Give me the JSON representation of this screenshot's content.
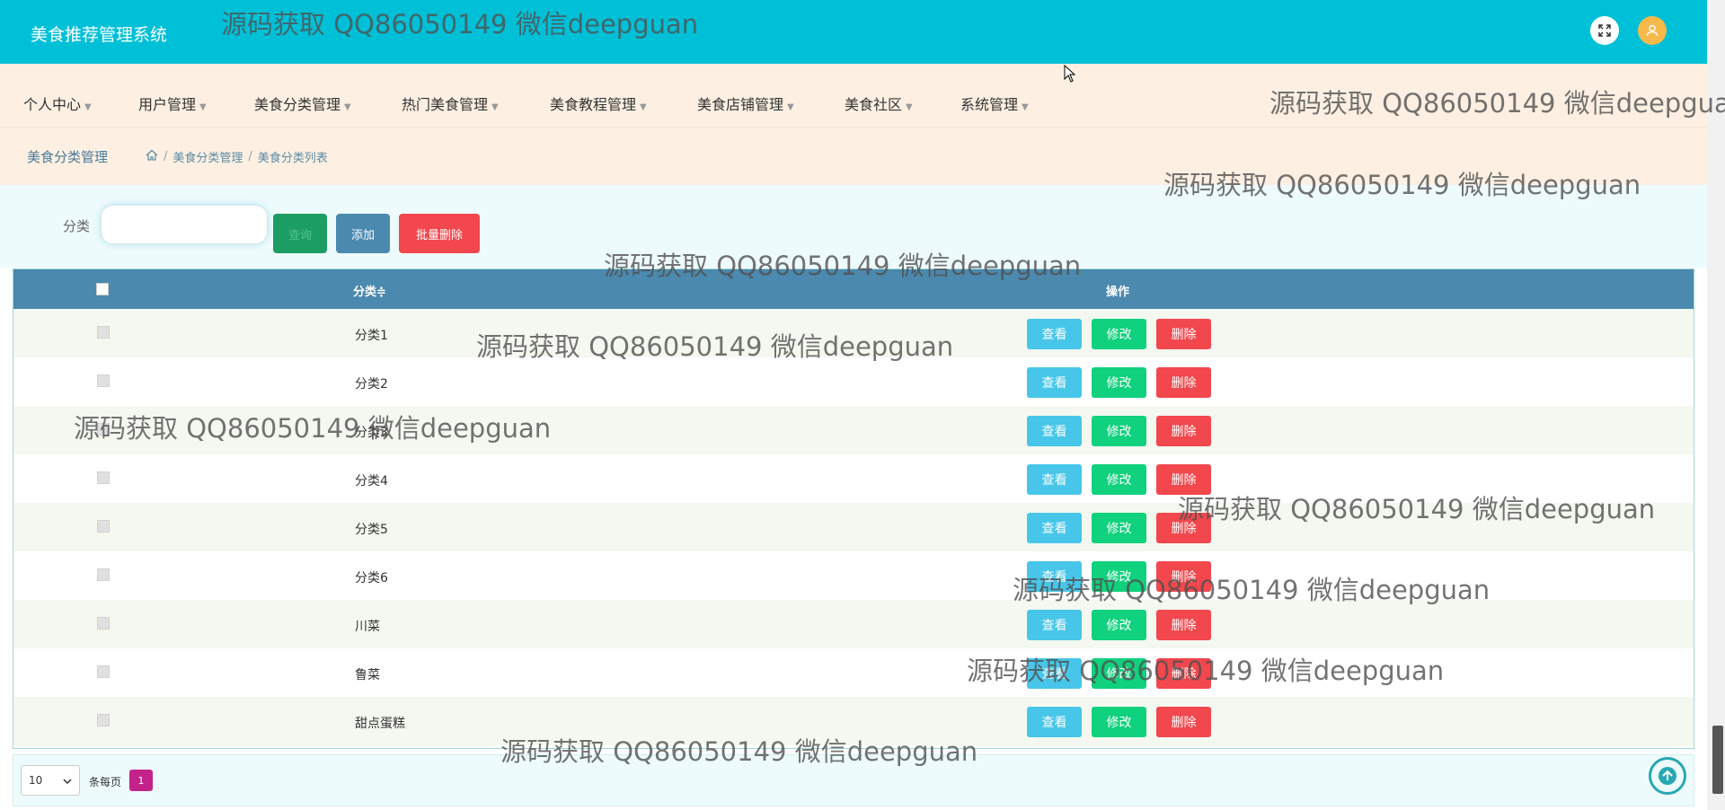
{
  "header": {
    "app_title": "美食推荐管理系统",
    "expand_icon": "expand-icon",
    "user_icon": "user-avatar-icon"
  },
  "nav": {
    "items": [
      {
        "label": "个人中心"
      },
      {
        "label": "用户管理"
      },
      {
        "label": "美食分类管理"
      },
      {
        "label": "热门美食管理"
      },
      {
        "label": "美食教程管理"
      },
      {
        "label": "美食店铺管理"
      },
      {
        "label": "美食社区"
      },
      {
        "label": "系统管理"
      }
    ]
  },
  "breadcrumb": {
    "title": "美食分类管理",
    "path": [
      "美食分类管理",
      "美食分类列表"
    ]
  },
  "search": {
    "label": "分类",
    "value": "",
    "query_label": "查询",
    "add_label": "添加",
    "batch_delete_label": "批量删除"
  },
  "table": {
    "headers": {
      "category": "分类",
      "sort_mark": "≑",
      "actions": "操作"
    },
    "rows": [
      {
        "name": "分类1"
      },
      {
        "name": "分类2"
      },
      {
        "name": "分类3"
      },
      {
        "name": "分类4"
      },
      {
        "name": "分类5"
      },
      {
        "name": "分类6"
      },
      {
        "name": "川菜"
      },
      {
        "name": "鲁菜"
      },
      {
        "name": "甜点蛋糕"
      }
    ],
    "view_label": "查看",
    "edit_label": "修改",
    "delete_label": "删除"
  },
  "pager": {
    "page_size": "10",
    "per_page_label": "条每页",
    "current_page": "1"
  },
  "watermark_text": "源码获取 QQ86050149 微信deepguan",
  "colors": {
    "topbar": "#00c0d8",
    "nav_bg": "#fdf0e2",
    "table_header": "#4b89ae",
    "view": "#47c6ea",
    "edit": "#10d17d",
    "delete": "#f2474d",
    "page_active": "#c3228a"
  }
}
